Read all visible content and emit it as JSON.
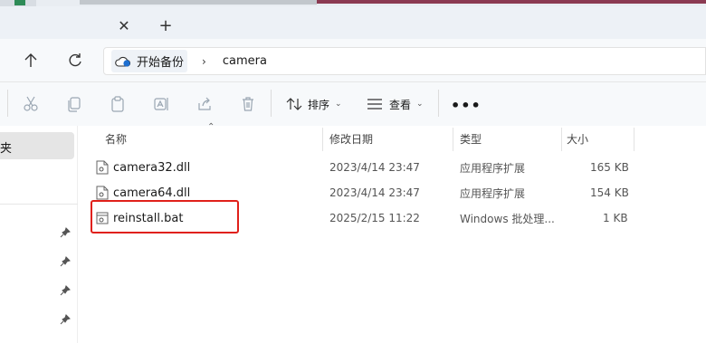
{
  "tabbar": {
    "close_label": "✕",
    "new_tab_label": "+"
  },
  "nav": {
    "breadcrumb_root": "开始备份",
    "breadcrumb_separator": "›",
    "breadcrumb_current": "camera"
  },
  "toolbar": {
    "sort_label": "排序",
    "view_label": "查看",
    "more_label": "•••"
  },
  "sidebar": {
    "selected_item": "夹"
  },
  "columns": {
    "name": "名称",
    "modified": "修改日期",
    "type": "类型",
    "size": "大小"
  },
  "files": [
    {
      "name": "camera32.dll",
      "modified": "2023/4/14 23:47",
      "type": "应用程序扩展",
      "size": "165 KB",
      "icon": "dll-file-icon"
    },
    {
      "name": "camera64.dll",
      "modified": "2023/4/14 23:47",
      "type": "应用程序扩展",
      "size": "154 KB",
      "icon": "dll-file-icon"
    },
    {
      "name": "reinstall.bat",
      "modified": "2025/2/15 11:22",
      "type": "Windows 批处理...",
      "size": "1 KB",
      "icon": "bat-file-icon"
    }
  ],
  "highlighted_file": "reinstall.bat",
  "colors": {
    "highlight_border": "#e0201a",
    "selected_sidebar_bg": "#e5e5e5"
  }
}
